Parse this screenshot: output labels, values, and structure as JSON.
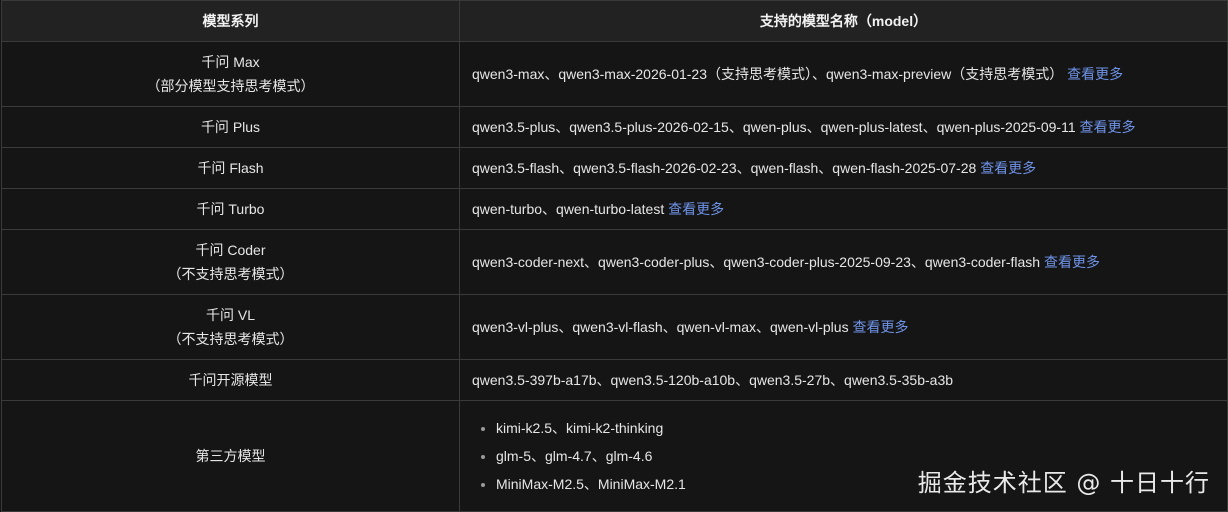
{
  "table": {
    "headers": [
      "模型系列",
      "支持的模型名称（model）"
    ],
    "more_label": "查看更多",
    "rows": [
      {
        "name": "千问 Max",
        "note": "（部分模型支持思考模式）",
        "models": "qwen3-max、qwen3-max-2026-01-23（支持思考模式）、qwen3-max-preview（支持思考模式）"
      },
      {
        "name": "千问 Plus",
        "models": "qwen3.5-plus、qwen3.5-plus-2026-02-15、qwen-plus、qwen-plus-latest、qwen-plus-2025-09-11"
      },
      {
        "name": "千问 Flash",
        "models": "qwen3.5-flash、qwen3.5-flash-2026-02-23、qwen-flash、qwen-flash-2025-07-28"
      },
      {
        "name": "千问 Turbo",
        "models": "qwen-turbo、qwen-turbo-latest"
      },
      {
        "name": "千问 Coder",
        "note": "（不支持思考模式）",
        "models": "qwen3-coder-next、qwen3-coder-plus、qwen3-coder-plus-2025-09-23、qwen3-coder-flash"
      },
      {
        "name": "千问 VL",
        "note": "（不支持思考模式）",
        "models": "qwen3-vl-plus、qwen3-vl-flash、qwen-vl-max、qwen-vl-plus"
      },
      {
        "name": "千问开源模型",
        "models": "qwen3.5-397b-a17b、qwen3.5-120b-a10b、qwen3.5-27b、qwen3.5-35b-a3b"
      },
      {
        "name": "第三方模型",
        "list": [
          "kimi-k2.5、kimi-k2-thinking",
          "glm-5、glm-4.7、glm-4.6",
          "MiniMax-M2.5、MiniMax-M2.1"
        ]
      }
    ]
  },
  "watermark": "掘金技术社区 @ 十日十行"
}
